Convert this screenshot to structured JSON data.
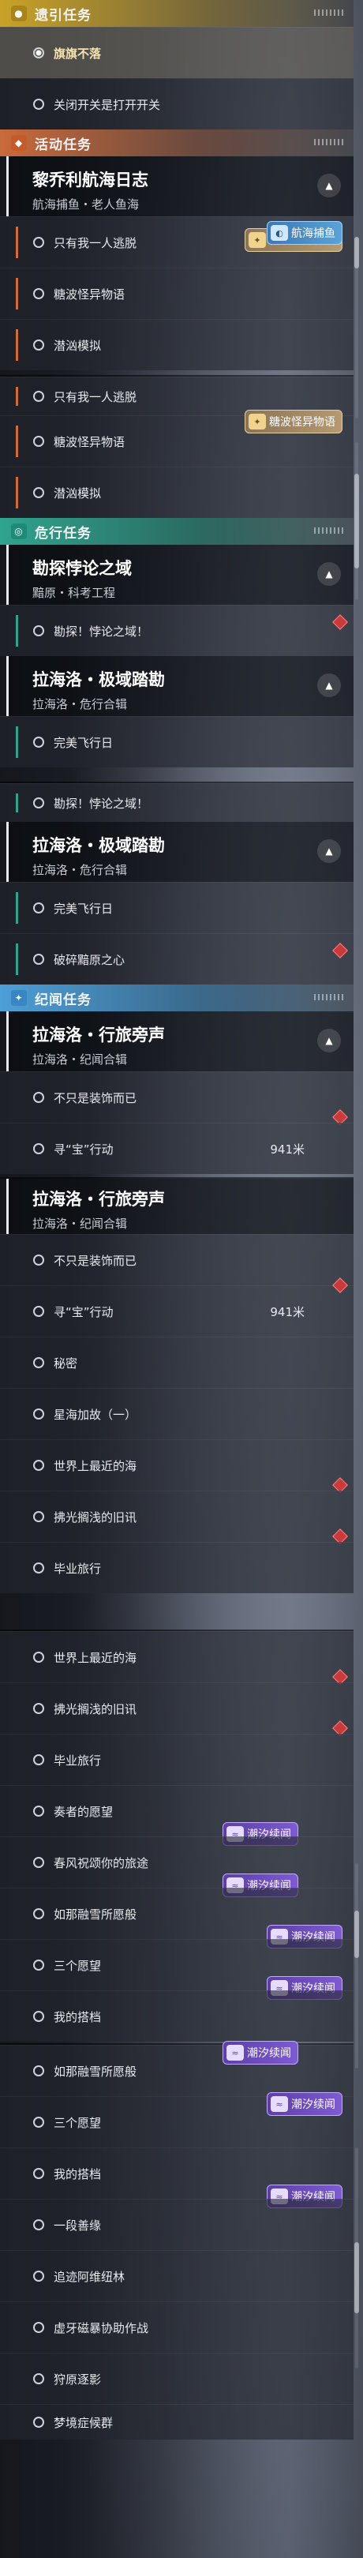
{
  "categories": {
    "guide": "遗引任务",
    "event": "活动任务",
    "danger": "危行任务",
    "story": "纪闻任务"
  },
  "chains": {
    "lachaolu": {
      "title": "黎乔利航海日志",
      "subtitle": "航海捕鱼・老人鱼海"
    },
    "kantan": {
      "title": "勘探悖论之域",
      "subtitle": "黯原・科考工程"
    },
    "lahailuo_jiyu": {
      "title": "拉海洛・极域踏勘",
      "subtitle": "拉海洛・危行合辑"
    },
    "lahailuo_xinglv": {
      "title": "拉海洛・行旅旁声",
      "subtitle": "拉海洛・纪闻合辑"
    }
  },
  "quests": {
    "q_qibiao": "旗旗不落",
    "q_guanbi": "关闭开关是打开开关",
    "q_zhiyou": "只有我一人逃脱",
    "q_tangbo": "糖波怪异物语",
    "q_qianxiong": "潜汹模拟",
    "q_kantan": "勘探！悖论之域！",
    "q_wanmei": "完美飞行日",
    "q_posui": "破碎黯原之心",
    "q_bushi": "不只是装饰而已",
    "q_xunbao": "寻“宝”行动",
    "q_mimi": "秘密",
    "q_xinghai": "星海加故（一）",
    "q_shijie": "世界上最近的海",
    "q_fuguang": "拂光搁浅的旧讯",
    "q_biye": "毕业旅行",
    "q_zouzhe": "奏者的愿望",
    "q_chunfeng": "春风祝颂你的旅途",
    "q_runa": "如那融雪所愿般",
    "q_sange": "三个愿望",
    "q_wode": "我的搭档",
    "q_yiduan": "一段善缘",
    "q_zhuimi": "追迹阿维纽林",
    "q_xuejing": "虚牙磁暴协助作战",
    "q_shouyuan": "狩原逐影",
    "q_mengjing": "梦境症候群"
  },
  "distance": "941米",
  "badges": {
    "hanghai": "航海捕鱼",
    "tangbo": "糖波怪异物语",
    "chaoxi": "潮汐续闻"
  }
}
